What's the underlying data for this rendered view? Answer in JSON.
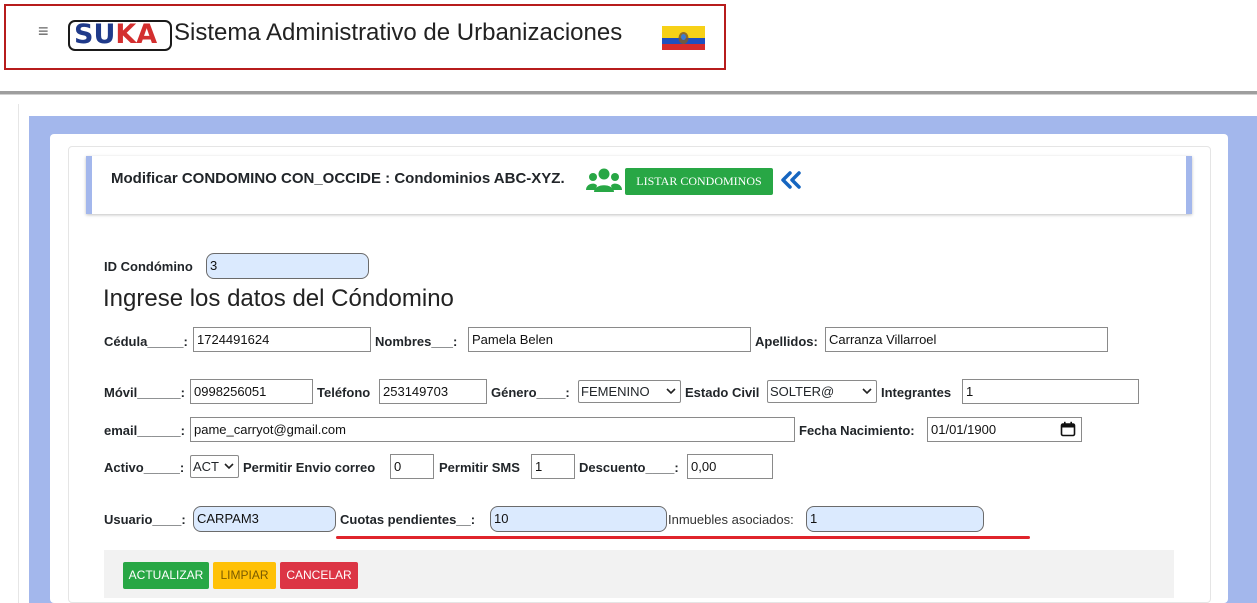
{
  "header": {
    "menu_icon": "hamburger-icon",
    "logo": {
      "part1": "SU",
      "part2": "KA"
    },
    "title": "Sistema Administrativo de Urbanizaciones",
    "flag_icon": "ecuador-flag-icon"
  },
  "page": {
    "title": "Modificar CONDOMINO CON_OCCIDE : Condominios ABC-XYZ.",
    "users_icon": "users-group-icon",
    "listar_button": "LISTAR CONDOMINOS",
    "back_icon": "double-chevron-left-icon"
  },
  "form": {
    "id_label": "ID Condómino",
    "id_value": "3",
    "heading": "Ingrese los datos del Cóndomino",
    "cedula_label": "Cédula_____:",
    "cedula_value": "1724491624",
    "nombres_label": "Nombres___:",
    "nombres_value": "Pamela Belen",
    "apellidos_label": "Apellidos:",
    "apellidos_value": "Carranza Villarroel",
    "movil_label": "Móvil______:",
    "movil_value": "0998256051",
    "telefono_label": "Teléfono",
    "telefono_value": "253149703",
    "genero_label": "Género____:",
    "genero_value": "FEMENINO",
    "estado_civil_label": "Estado Civil",
    "estado_civil_value": "SOLTER@",
    "integrantes_label": "Integrantes",
    "integrantes_value": "1",
    "email_label": "email______:",
    "email_value": "pame_carryot@gmail.com",
    "fecha_label": "Fecha Nacimiento:",
    "fecha_value": "01/01/1900",
    "activo_label": "Activo_____:",
    "activo_value": "ACT",
    "envio_label": "Permitir Envio correo",
    "envio_value": "0",
    "sms_label": "Permitir SMS",
    "sms_value": "1",
    "descuento_label": "Descuento____:",
    "descuento_value": "0,00",
    "usuario_label": "Usuario____:",
    "usuario_value": "CARPAM3",
    "cuotas_label": "Cuotas pendientes__:",
    "cuotas_value": "10",
    "inmuebles_label": "Inmuebles asociados:",
    "inmuebles_value": "1"
  },
  "actions": {
    "actualizar": "ACTUALIZAR",
    "limpiar": "LIMPIAR",
    "cancelar": "CANCELAR"
  },
  "colors": {
    "green": "#28a745",
    "yellow": "#ffc107",
    "red": "#dc3545",
    "frame_blue": "#a3b7ec",
    "readonly_blue": "#dbeafe"
  }
}
